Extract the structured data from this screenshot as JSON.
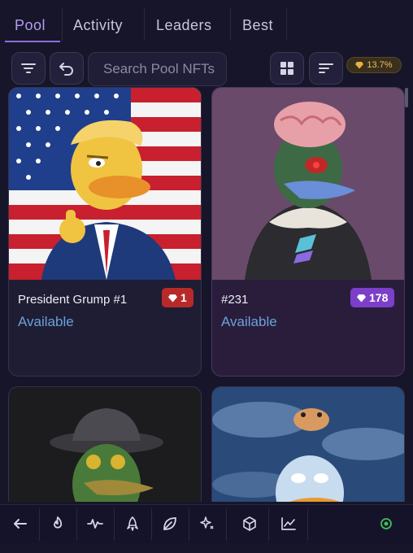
{
  "tabs": [
    {
      "label": "Pool",
      "active": true
    },
    {
      "label": "Activity",
      "active": false
    },
    {
      "label": "Leaders",
      "active": false
    },
    {
      "label": "Best",
      "active": false
    }
  ],
  "toolbar": {
    "search_placeholder": "Search Pool NFTs",
    "yield_value": "13.7%"
  },
  "icons": {
    "filter": "filter-icon",
    "undo": "undo-icon",
    "grid": "grid-view-icon",
    "sort": "sort-icon",
    "gem": "gem-icon"
  },
  "cards": [
    {
      "title": "President Grump  #1",
      "status": "Available",
      "badge": "1",
      "badge_color": "#b82a2a"
    },
    {
      "title": "#231",
      "status": "Available",
      "badge": "178",
      "badge_color": "#7b3fc9"
    },
    {
      "title": "",
      "status": "",
      "badge": ""
    },
    {
      "title": "",
      "status": "",
      "badge": ""
    }
  ],
  "bottom_nav": [
    {
      "icon": "arrow-left-icon"
    },
    {
      "icon": "flame-icon"
    },
    {
      "icon": "activity-pulse-icon"
    },
    {
      "icon": "rocket-icon"
    },
    {
      "icon": "leaf-icon"
    },
    {
      "icon": "sparkles-icon"
    },
    {
      "icon": "cube-icon"
    },
    {
      "icon": "chart-line-icon"
    },
    {
      "icon": "status-indicator-icon"
    }
  ],
  "colors": {
    "background": "#17152a",
    "accent": "#b49cf0",
    "status_link": "#6aa2da",
    "online": "#3fbf5a"
  }
}
